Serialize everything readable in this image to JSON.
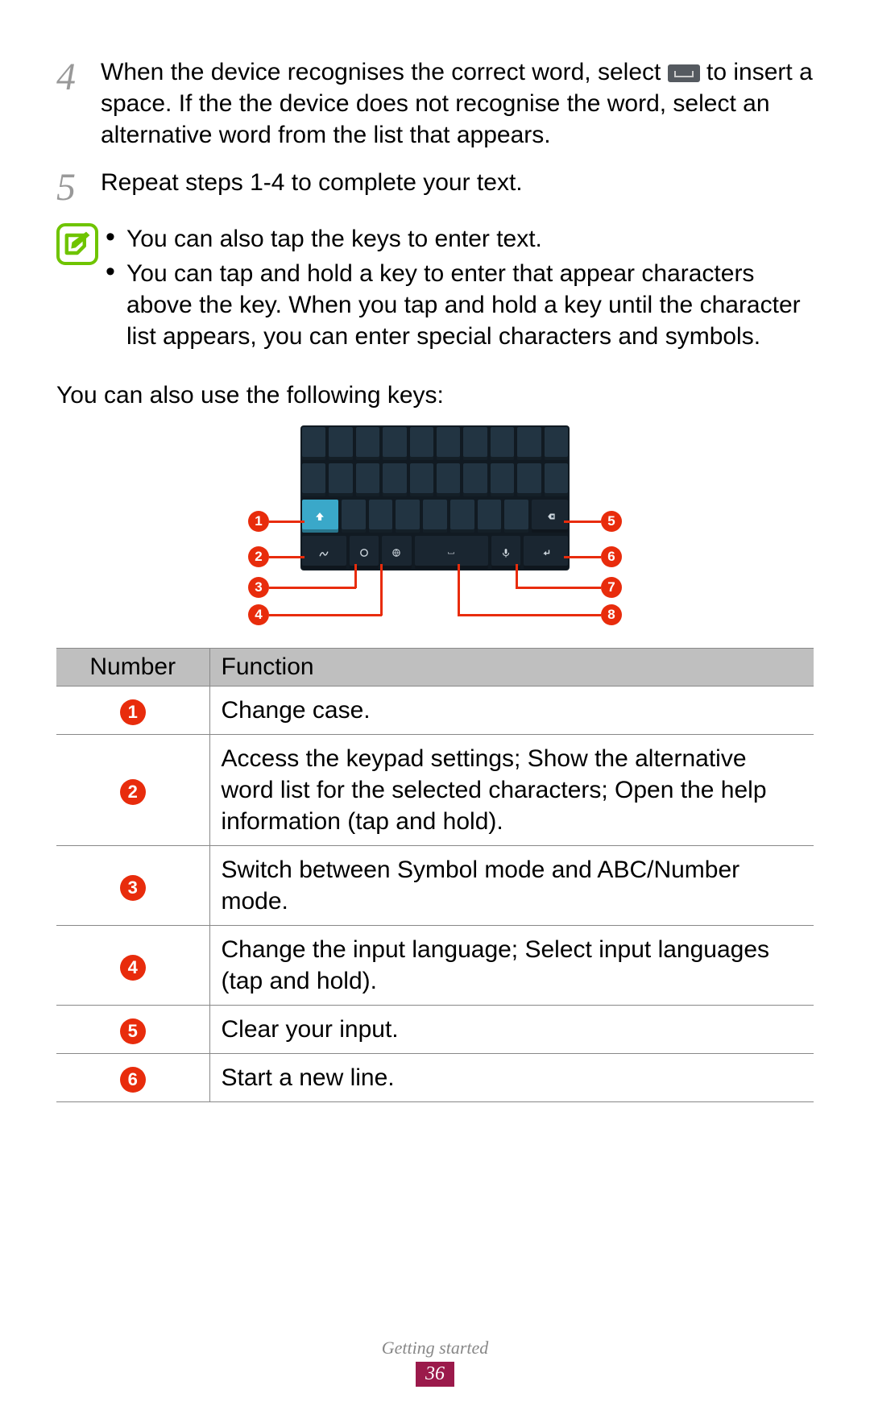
{
  "steps": {
    "s4": {
      "num": "4",
      "text_a": "When the device recognises the correct word, select ",
      "text_b": " to insert a space. If the the device does not recognise the word, select an alternative word from the list that appears."
    },
    "s5": {
      "num": "5",
      "text": "Repeat steps 1-4 to complete your text."
    }
  },
  "note": {
    "bullets": [
      "You can also tap the keys to enter text.",
      "You can tap and hold a key to enter that appear characters above the key. When you tap and hold a key until the character list appears, you can enter special characters and symbols."
    ]
  },
  "intro": "You can also use the following keys:",
  "callouts": {
    "left": [
      "1",
      "2",
      "3",
      "4"
    ],
    "right": [
      "5",
      "6",
      "7",
      "8"
    ]
  },
  "table": {
    "header": {
      "number": "Number",
      "function": "Function"
    },
    "rows": [
      {
        "n": "1",
        "f": "Change case."
      },
      {
        "n": "2",
        "f": "Access the keypad settings; Show the alternative word list for the selected characters; Open the help information (tap and hold)."
      },
      {
        "n": "3",
        "f": "Switch between Symbol mode and ABC/Number mode."
      },
      {
        "n": "4",
        "f": "Change the input language; Select input languages (tap and hold)."
      },
      {
        "n": "5",
        "f": "Clear your input."
      },
      {
        "n": "6",
        "f": "Start a new line."
      }
    ]
  },
  "footer": {
    "section": "Getting started",
    "page": "36"
  }
}
